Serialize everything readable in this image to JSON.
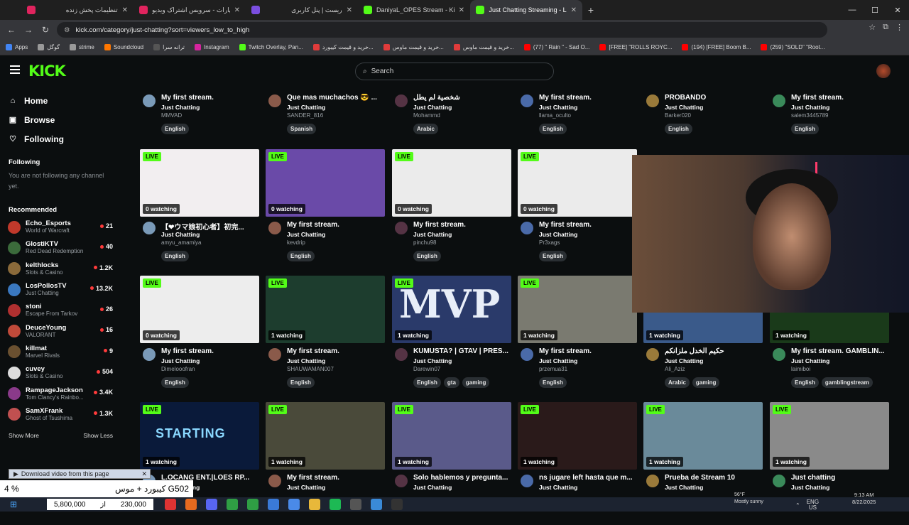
{
  "browser": {
    "tabs": [
      {
        "title": "تنظیمات پخش زنده",
        "color": "#e0245e"
      },
      {
        "title": "آپارات - سرویس اشتراک ویدیو",
        "color": "#e0245e"
      },
      {
        "title": "ریست | پنل کاربری",
        "color": "#7a4ee0"
      },
      {
        "title": "DaniyaL_OPES Stream - Kick Da",
        "color": "#53fc18"
      },
      {
        "title": "Just Chatting Streaming - L",
        "color": "#53fc18"
      }
    ],
    "url": "kick.com/category/just-chatting?sort=viewers_low_to_high",
    "bookmarks": [
      {
        "label": "Apps",
        "color": "#4285f4"
      },
      {
        "label": "گوگل",
        "color": "#999"
      },
      {
        "label": "strime",
        "color": "#999"
      },
      {
        "label": "Soundcloud",
        "color": "#ff7700"
      },
      {
        "label": "ترانه سرا",
        "color": "#555"
      },
      {
        "label": "Instagram",
        "color": "#d6249f"
      },
      {
        "label": "Twitch Overlay, Pan...",
        "color": "#53fc18"
      },
      {
        "label": "خرید و قیمت کیبورد...",
        "color": "#e03b3b"
      },
      {
        "label": "خرید و قیمت ماوس...",
        "color": "#e03b3b"
      },
      {
        "label": "خرید و قیمت ماوس...",
        "color": "#e03b3b"
      },
      {
        "label": "(77) \" Rain \" - Sad O...",
        "color": "#ff0000"
      },
      {
        "label": "[FREE] \"ROLLS ROYC...",
        "color": "#ff0000"
      },
      {
        "label": "(194) [FREE] Boom B...",
        "color": "#ff0000"
      },
      {
        "label": "(259) \"SOLD\" \"Root...",
        "color": "#ff0000"
      }
    ]
  },
  "kick": {
    "logo": "KICK",
    "search_placeholder": "Search",
    "nav": [
      {
        "label": "Home",
        "icon": "⌂"
      },
      {
        "label": "Browse",
        "icon": "▣"
      },
      {
        "label": "Following",
        "icon": "♡"
      }
    ],
    "following_title": "Following",
    "following_note": "You are not following any channel yet.",
    "recommended_title": "Recommended",
    "recommended": [
      {
        "name": "Echo_Esports",
        "category": "World of Warcraft",
        "viewers": "21",
        "color": "#c0392b"
      },
      {
        "name": "GlostiKTV",
        "category": "Red Dead Redemption",
        "viewers": "40",
        "color": "#3b6b3b"
      },
      {
        "name": "kelthlocks",
        "category": "Slots & Casino",
        "viewers": "1.2K",
        "color": "#8a6a3a"
      },
      {
        "name": "LosPollosTV",
        "category": "Just Chatting",
        "viewers": "13.2K",
        "color": "#3a78c0"
      },
      {
        "name": "stoni",
        "category": "Escape From Tarkov",
        "viewers": "26",
        "color": "#b03030"
      },
      {
        "name": "DeuceYoung",
        "category": "VALORANT",
        "viewers": "16",
        "color": "#c04a3a"
      },
      {
        "name": "killmat",
        "category": "Marvel Rivals",
        "viewers": "9",
        "color": "#6a5030"
      },
      {
        "name": "cuvey",
        "category": "Slots & Casino",
        "viewers": "504",
        "color": "#dddddd"
      },
      {
        "name": "RampageJackson",
        "category": "Tom Clancy's Rainbo...",
        "viewers": "3.4K",
        "color": "#8a3a8a"
      },
      {
        "name": "SamXFrank",
        "category": "Ghost of Tsushima",
        "viewers": "1.3K",
        "color": "#c05050"
      }
    ],
    "show_more": "Show More",
    "show_less": "Show Less"
  },
  "streams_row0": [
    {
      "title": "My first stream.",
      "category": "Just Chatting",
      "user": "MMVAD",
      "tags": [
        "English"
      ]
    },
    {
      "title": "Que mas muchachos 😎 ...",
      "category": "Just Chatting",
      "user": "SANDER_816",
      "tags": [
        "Spanish"
      ]
    },
    {
      "title": "شخصية لم يطل",
      "category": "Just Chatting",
      "user": "Mohammd",
      "tags": [
        "Arabic"
      ]
    },
    {
      "title": "My first stream.",
      "category": "Just Chatting",
      "user": "llama_oculto",
      "tags": [
        "English"
      ]
    },
    {
      "title": "PROBANDO",
      "category": "Just Chatting",
      "user": "Barker020",
      "tags": [
        "English"
      ]
    },
    {
      "title": "My first stream.",
      "category": "Just Chatting",
      "user": "salem3445789",
      "tags": [
        "English"
      ]
    }
  ],
  "streams_row1": [
    {
      "live": "LIVE",
      "watching": "0 watching",
      "title": "【❤ウマ娘初心者】初完...",
      "category": "Just Chatting",
      "user": "amyu_amamiya",
      "tags": [
        "English"
      ],
      "thumb": "#f2eef0"
    },
    {
      "live": "LIVE",
      "watching": "0 watching",
      "title": "My first stream.",
      "category": "Just Chatting",
      "user": "kevdrip",
      "tags": [
        "English"
      ],
      "thumb": "#6a4aa8"
    },
    {
      "live": "LIVE",
      "watching": "0 watching",
      "title": "My first stream.",
      "category": "Just Chatting",
      "user": "pinchu98",
      "tags": [
        "English"
      ],
      "thumb": "#ebebeb"
    },
    {
      "live": "LIVE",
      "watching": "0 watching",
      "title": "My first stream.",
      "category": "Just Chatting",
      "user": "Pr3xags",
      "tags": [
        "English"
      ],
      "thumb": "#ebebeb"
    }
  ],
  "streams_row2": [
    {
      "live": "LIVE",
      "watching": "0 watching",
      "title": "My first stream.",
      "category": "Just Chatting",
      "user": "Dimelooofran",
      "tags": [
        "English"
      ],
      "thumb": "#ededed"
    },
    {
      "live": "LIVE",
      "watching": "1 watching",
      "title": "My first stream.",
      "category": "Just Chatting",
      "user": "SHAUWAMAN007",
      "tags": [
        "English"
      ],
      "thumb": "#1d3d2e"
    },
    {
      "live": "LIVE",
      "watching": "1 watching",
      "title": "KUMUSTA? | GTAV | PRES...",
      "category": "Just Chatting",
      "user": "Darewin07",
      "tags": [
        "English",
        "gta",
        "gaming"
      ],
      "thumb": "#2a3a6a"
    },
    {
      "live": "LIVE",
      "watching": "1 watching",
      "title": "My first stream.",
      "category": "Just Chatting",
      "user": "przemua31",
      "tags": [
        "English"
      ],
      "thumb": "#7a7a70"
    },
    {
      "live": "LIVE",
      "watching": "1 watching",
      "title": "حكيم الخدل ملزانكم",
      "category": "Just Chatting",
      "user": "Ali_Aziz",
      "tags": [
        "Arabic",
        "gaming"
      ],
      "thumb": "#3a5a8a"
    },
    {
      "live": "LIVE",
      "watching": "1 watching",
      "title": "My first stream. GAMBLIN...",
      "category": "Just Chatting",
      "user": "laimiboi",
      "tags": [
        "English",
        "gamblingstream"
      ],
      "thumb": "#1a3a1a"
    }
  ],
  "streams_row3": [
    {
      "live": "LIVE",
      "watching": "1 watching",
      "title": "L.OCANG ENT.|LOES RP...",
      "category": "Just Chatting",
      "thumb": "#0a1a3a"
    },
    {
      "live": "LIVE",
      "watching": "1 watching",
      "title": "My first stream.",
      "category": "Just Chatting",
      "thumb": "#4a4a3a"
    },
    {
      "live": "LIVE",
      "watching": "1 watching",
      "title": "Solo hablemos y pregunta...",
      "category": "Just Chatting",
      "thumb": "#5a5a8a"
    },
    {
      "live": "LIVE",
      "watching": "1 watching",
      "title": "ns jugare left hasta que m...",
      "category": "Just Chatting",
      "thumb": "#2a1a1a"
    },
    {
      "live": "LIVE",
      "watching": "1 watching",
      "title": "Prueba de Stream 10",
      "category": "Just Chatting",
      "thumb": "#6a8a9a"
    },
    {
      "live": "LIVE",
      "watching": "1 watching",
      "title": "Just chatting",
      "category": "Just Chatting",
      "thumb": "#8a8a8a"
    }
  ],
  "starting_text": "STARTING",
  "mvp_text": "MVP",
  "download_bar": "Download video from this page",
  "overlay": {
    "left": "4 %",
    "right": "کیبورد + موس G502"
  },
  "price": {
    "left": "5,800,000",
    "mid": "از",
    "right": "230,000"
  },
  "weather": {
    "temp": "56°F",
    "desc": "Mostly sunny"
  },
  "tray": {
    "lang": "ENG",
    "region": "US"
  },
  "clock": {
    "time": "9:13 AM",
    "date": "8/22/2025"
  }
}
